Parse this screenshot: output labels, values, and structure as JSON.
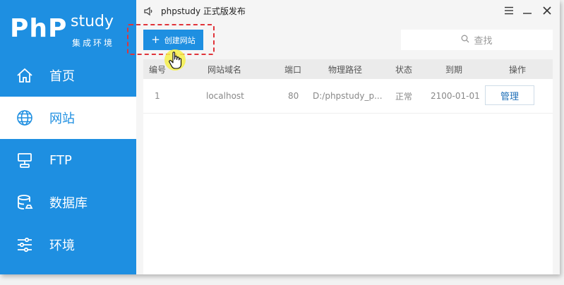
{
  "app": {
    "logo_main": "PhP",
    "logo_study": "study",
    "logo_sub": "集成环境"
  },
  "sidebar": {
    "items": [
      {
        "label": "首页",
        "icon": "home-icon"
      },
      {
        "label": "网站",
        "icon": "globe-icon",
        "active": true
      },
      {
        "label": "FTP",
        "icon": "server-icon"
      },
      {
        "label": "数据库",
        "icon": "database-icon"
      },
      {
        "label": "环境",
        "icon": "sliders-icon"
      }
    ]
  },
  "topbar": {
    "notice": "phpstudy 正式版发布",
    "notice_icon": "speaker-icon"
  },
  "toolbar": {
    "create_label": "创建网站",
    "search_placeholder": "查找"
  },
  "table": {
    "headers": [
      "编号",
      "网站域名",
      "端口",
      "物理路径",
      "状态",
      "到期",
      "操作"
    ],
    "rows": [
      {
        "id": "1",
        "domain": "localhost",
        "port": "80",
        "path": "D:/phpstudy_p...",
        "status": "正常",
        "expires": "2100-01-01",
        "action": "管理"
      }
    ]
  },
  "colors": {
    "accent": "#1e8fe1",
    "highlight_border": "#e0343a"
  }
}
